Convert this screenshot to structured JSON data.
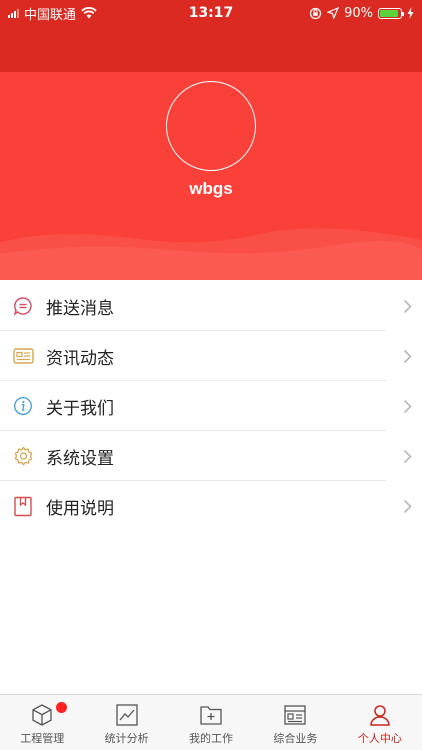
{
  "status_bar": {
    "carrier": "中国联通",
    "time": "13:17",
    "battery": "90%",
    "battery_level": 0.9
  },
  "profile": {
    "username": "wbgs"
  },
  "menu": [
    {
      "label": "推送消息",
      "icon": "chat-bubble-icon"
    },
    {
      "label": "资讯动态",
      "icon": "newspaper-icon"
    },
    {
      "label": "关于我们",
      "icon": "info-icon"
    },
    {
      "label": "系统设置",
      "icon": "gear-icon"
    },
    {
      "label": "使用说明",
      "icon": "bookmark-icon"
    }
  ],
  "tabs": [
    {
      "label": "工程管理",
      "icon": "cube-icon",
      "badge": true
    },
    {
      "label": "统计分析",
      "icon": "chart-icon"
    },
    {
      "label": "我的工作",
      "icon": "folder-add-icon"
    },
    {
      "label": "综合业务",
      "icon": "dashboard-icon"
    },
    {
      "label": "个人中心",
      "icon": "person-icon",
      "active": true
    }
  ],
  "colors": {
    "header": "#f94039",
    "status": "#da2a22",
    "active_tab": "#c8241d"
  }
}
